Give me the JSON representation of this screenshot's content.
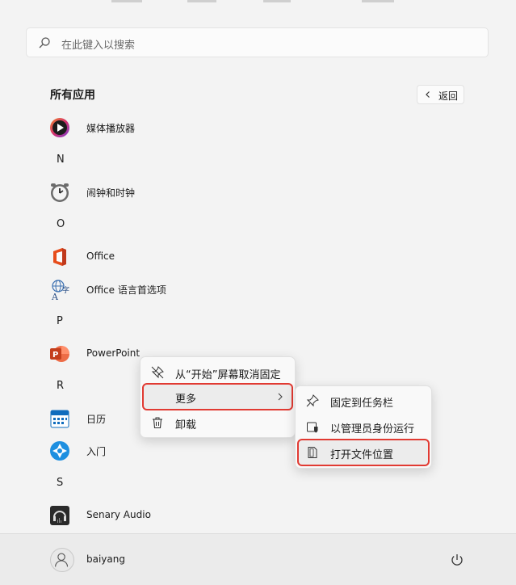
{
  "search": {
    "placeholder": "在此键入以搜索"
  },
  "header": {
    "title": "所有应用",
    "back_label": "返回"
  },
  "apps": [
    {
      "name": "媒体播放器",
      "icon": "media-player-icon"
    },
    {
      "letter": "N"
    },
    {
      "name": "闹钟和时钟",
      "icon": "alarm-clock-icon"
    },
    {
      "letter": "O"
    },
    {
      "name": "Office",
      "icon": "office-icon"
    },
    {
      "name": "Office 语言首选项",
      "icon": "language-preferences-icon"
    },
    {
      "letter": "P"
    },
    {
      "name": "PowerPoint",
      "icon": "powerpoint-icon"
    },
    {
      "letter": "R"
    },
    {
      "name": "日历",
      "icon": "calendar-icon"
    },
    {
      "name": "入门",
      "icon": "get-started-icon"
    },
    {
      "letter": "S"
    },
    {
      "name": "Senary Audio",
      "icon": "senary-audio-icon"
    }
  ],
  "context_menu": {
    "items": [
      {
        "label": "从“开始”屏幕取消固定",
        "icon": "unpin-icon"
      },
      {
        "label": "更多",
        "icon": "",
        "has_submenu": true,
        "highlighted": true
      },
      {
        "label": "卸载",
        "icon": "trash-icon"
      }
    ]
  },
  "submenu": {
    "items": [
      {
        "label": "固定到任务栏",
        "icon": "pin-icon"
      },
      {
        "label": "以管理员身份运行",
        "icon": "admin-shield-icon"
      },
      {
        "label": "打开文件位置",
        "icon": "file-location-icon",
        "highlighted": true
      }
    ]
  },
  "footer": {
    "username": "baiyang"
  },
  "colors": {
    "highlight": "#e13a32",
    "powerpoint": "#c43e1c",
    "office": "#e74c1a",
    "accent": "#0067c0"
  }
}
